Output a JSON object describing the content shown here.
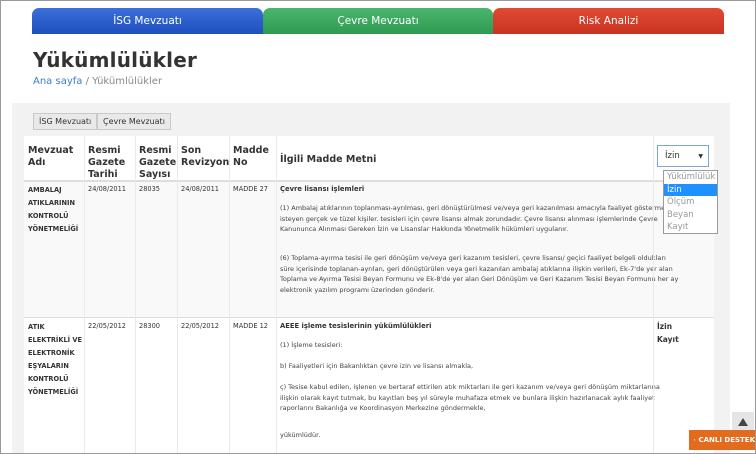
{
  "top_tabs": [
    {
      "label": "İSG Mevzuatı",
      "color": "#2a5bcc"
    },
    {
      "label": "Çevre Mevzuatı",
      "color": "#3aa75e"
    },
    {
      "label": "Risk Analizi",
      "color": "#d63e28"
    }
  ],
  "page": {
    "title": "Yükümlülükler",
    "breadcrumb_home": "Ana sayfa",
    "breadcrumb_sep": " / ",
    "breadcrumb_current": "Yükümlülükler"
  },
  "filters": {
    "isg": "İSG Mevzuatı",
    "cevre": "Çevre Mevzuatı"
  },
  "table": {
    "headers": {
      "law": "Mevzuat Adı",
      "gazette_date": "Resmi Gazete Tarihi",
      "gazette_no": "Resmi Gazete Sayısı",
      "last_revision": "Son Revizyon",
      "article_no": "Madde No",
      "article_text": "İlgili Madde Metni"
    },
    "type_filter": {
      "selected": "İzin",
      "options": [
        "Yükümlülük",
        "İzin",
        "Ölçüm",
        "Beyan",
        "Kayıt"
      ]
    },
    "rows": [
      {
        "law": "AMBALAJ ATIKLARININ KONTROLÜ YÖNETMELİĞİ",
        "gazette_date": "24/08/2011",
        "gazette_no": "28035",
        "last_revision": "24/08/2011",
        "article_no": "MADDE 27",
        "title": "Çevre lisansı işlemleri",
        "paragraphs": [
          "(1) Ambalaj atıklarının toplanması-ayrılması, geri dönüştürülmesi ve/veya geri kazanılması amacıyla faaliyet göstermek isteyen gerçek ve tüzel kişiler. tesisleri için çevre lisansı almak zorundadır. Çevre lisansı alınması işlemlerinde Çevre Kanununca Alınması Gereken İzin ve Lisanslar Hakkında Yönetmelik hükümleri uygulanır.",
          "(6) Toplama-ayırma tesisi ile geri dönüşüm ve/veya geri kazanım tesisleri, çevre lisansı/ geçici faaliyet belgeli oldukları süre içerisinde toplanan-ayrılan, geri dönüştürülen veya geri kazanılan ambalaj atıklarına ilişkin verileri, Ek-7'de yer alan Toplama ve Ayırma Tesisi Beyan Formunu ve Ek-8'de yer alan Geri Dönüşüm ve Geri Kazanım Tesisi Beyan Formunu her ay elektronik yazılım programı üzerinden gönderir."
        ],
        "type": ""
      },
      {
        "law": "ATIK ELEKTRİKLİ VE ELEKTRONİK EŞYALARIN KONTROLÜ YÖNETMELİĞİ",
        "gazette_date": "22/05/2012",
        "gazette_no": "28300",
        "last_revision": "22/05/2012",
        "article_no": "MADDE 12",
        "title": "AEEE işleme tesislerinin yükümlülükleri",
        "paragraphs": [
          "(1) İşleme tesisleri:",
          "b) Faaliyetleri için Bakanlıktan çevre izin ve lisansı almakla,",
          "ç) Tesise kabul edilen, işlenen ve bertaraf ettirilen atık miktarları ile geri kazanım ve/veya geri dönüşüm miktarlarına ilişkin olarak kayıt tutmak, bu kayıtları beş yıl süreyle muhafaza etmek ve bunlara ilişkin hazırlanacak aylık faaliyet raporlarını Bakanlığa ve Koordinasyon Merkezine göndermekle,",
          "yükümlüdür."
        ],
        "type": "İzin\nKayıt"
      }
    ]
  },
  "live_support": "CANLI DESTEK"
}
